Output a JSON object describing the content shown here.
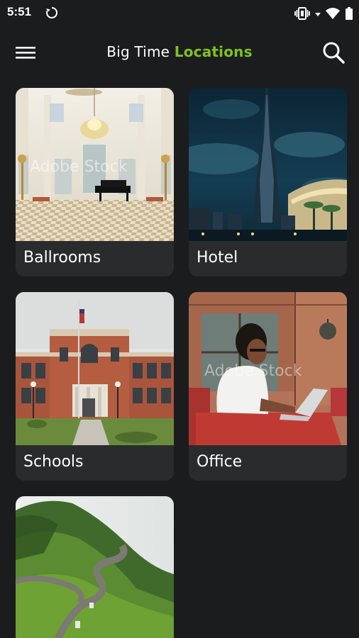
{
  "status_bar": {
    "time": "5:51",
    "icons": [
      "sync-icon",
      "vibrate-icon",
      "wifi-icon",
      "battery-icon"
    ]
  },
  "app_bar": {
    "title_part1": "Big Time",
    "title_part2": "Locations",
    "accent_color": "#7fc31c",
    "menu_icon": "hamburger-menu-icon",
    "search_icon": "search-icon"
  },
  "categories": [
    {
      "label": "Ballrooms"
    },
    {
      "label": "Hotel"
    },
    {
      "label": "Schools"
    },
    {
      "label": "Office"
    },
    {
      "label": ""
    }
  ],
  "theme": {
    "background": "#1b1c1e",
    "card_background": "#2a2b2d"
  }
}
